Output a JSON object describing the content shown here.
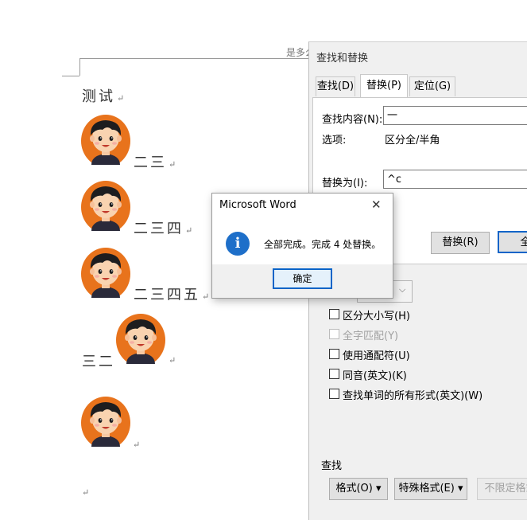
{
  "document": {
    "header_text": "是多么",
    "title_line": "测试",
    "lines": [
      "二三",
      "二三四",
      "二三四五",
      "三二",
      ""
    ],
    "para_mark": "↵"
  },
  "find_replace": {
    "title": "查找和替换",
    "tabs": [
      "查找(D)",
      "替换(P)",
      "定位(G)"
    ],
    "find_label": "查找内容(N):",
    "find_value": "一",
    "options_label": "选项:",
    "options_value": "区分全/半角",
    "replace_label": "替换为(I):",
    "replace_value": "^c",
    "replace_button": "替换(R)",
    "replace_all_button": "全",
    "checkboxes": [
      {
        "label": "区分大小写(H)",
        "disabled": false
      },
      {
        "label": "全字匹配(Y)",
        "disabled": true
      },
      {
        "label": "使用通配符(U)",
        "disabled": false
      },
      {
        "label": "同音(英文)(K)",
        "disabled": false
      },
      {
        "label": "查找单词的所有形式(英文)(W)",
        "disabled": false
      }
    ],
    "find_section": "查找",
    "format_button": "格式(O) ▾",
    "special_button": "特殊格式(E) ▾",
    "no_format_button": "不限定格式"
  },
  "message_box": {
    "title": "Microsoft Word",
    "close": "✕",
    "icon": "i",
    "text": "全部完成。完成 4 处替换。",
    "ok": "确定"
  },
  "colors": {
    "accent": "#0a64c8",
    "info": "#1e6fc9",
    "avatar_bg": "#e8731c"
  }
}
